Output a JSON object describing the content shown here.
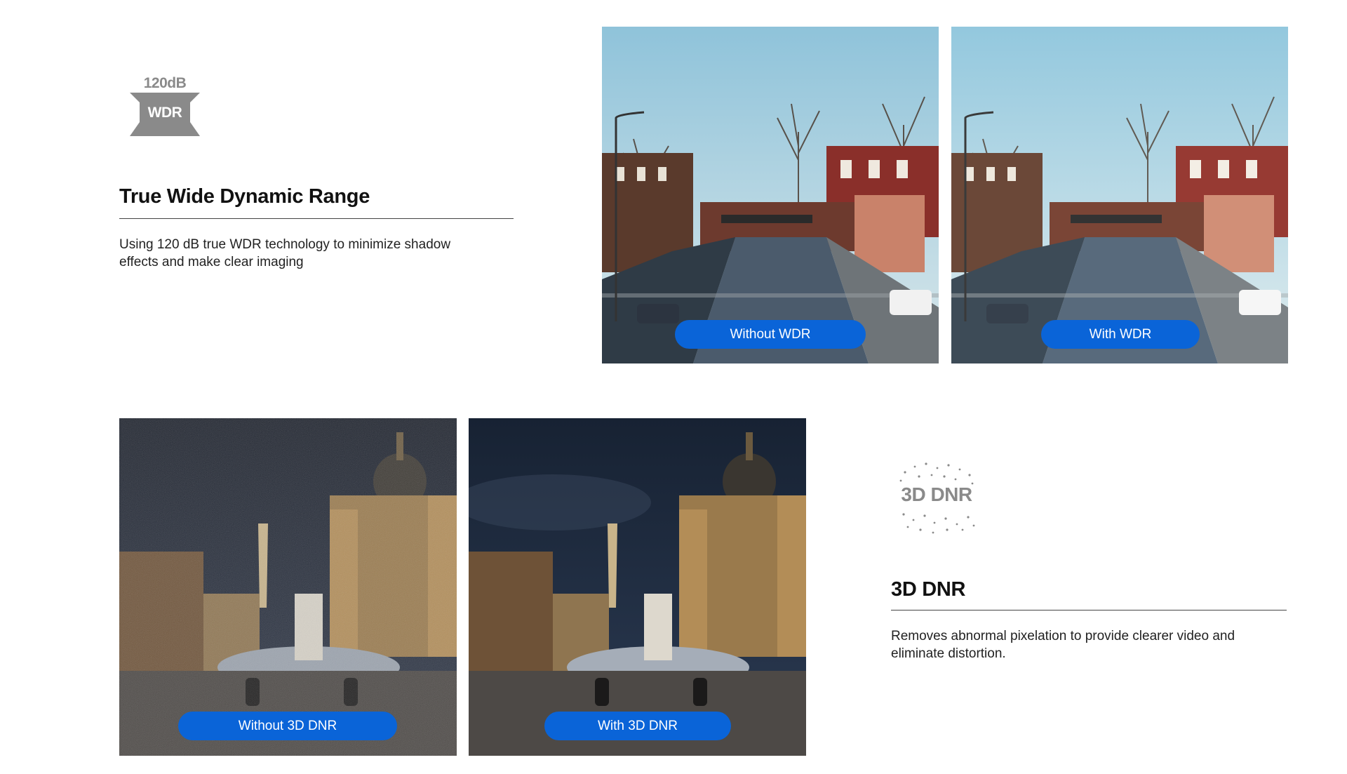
{
  "wdr": {
    "icon_top_text": "120dB",
    "icon_mid_text": "WDR",
    "title": "True Wide Dynamic Range",
    "description": "Using 120 dB true WDR technology to minimize shadow effects and make clear imaging",
    "photos": [
      {
        "label": "Without WDR"
      },
      {
        "label": "With WDR"
      }
    ]
  },
  "dnr": {
    "icon_text": "3D DNR",
    "title": "3D DNR",
    "description": "Removes abnormal pixelation to provide clearer video and eliminate distortion.",
    "photos": [
      {
        "label": "Without 3D DNR"
      },
      {
        "label": "With 3D DNR"
      }
    ]
  },
  "colors": {
    "pill": "#0a64d8",
    "icon_gray": "#8a8a8a"
  }
}
